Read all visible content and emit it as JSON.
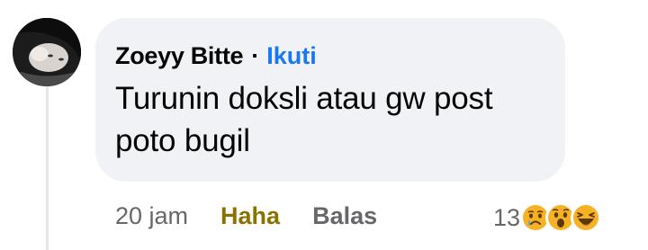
{
  "comment": {
    "author": "Zoeyy Bitte",
    "separator": "·",
    "follow_label": "Ikuti",
    "text": "Turunin doksli atau gw post poto bugil"
  },
  "actions": {
    "time": "20 jam",
    "haha_label": "Haha",
    "reply_label": "Balas"
  },
  "reactions": {
    "count": "13",
    "types": [
      "sad-icon",
      "wow-icon",
      "haha-icon"
    ]
  },
  "colors": {
    "bubble": "#f0f2f5",
    "link": "#1877f2",
    "haha": "#8a7100",
    "meta": "#65676b",
    "reaction_yellow": "#f7b125"
  }
}
